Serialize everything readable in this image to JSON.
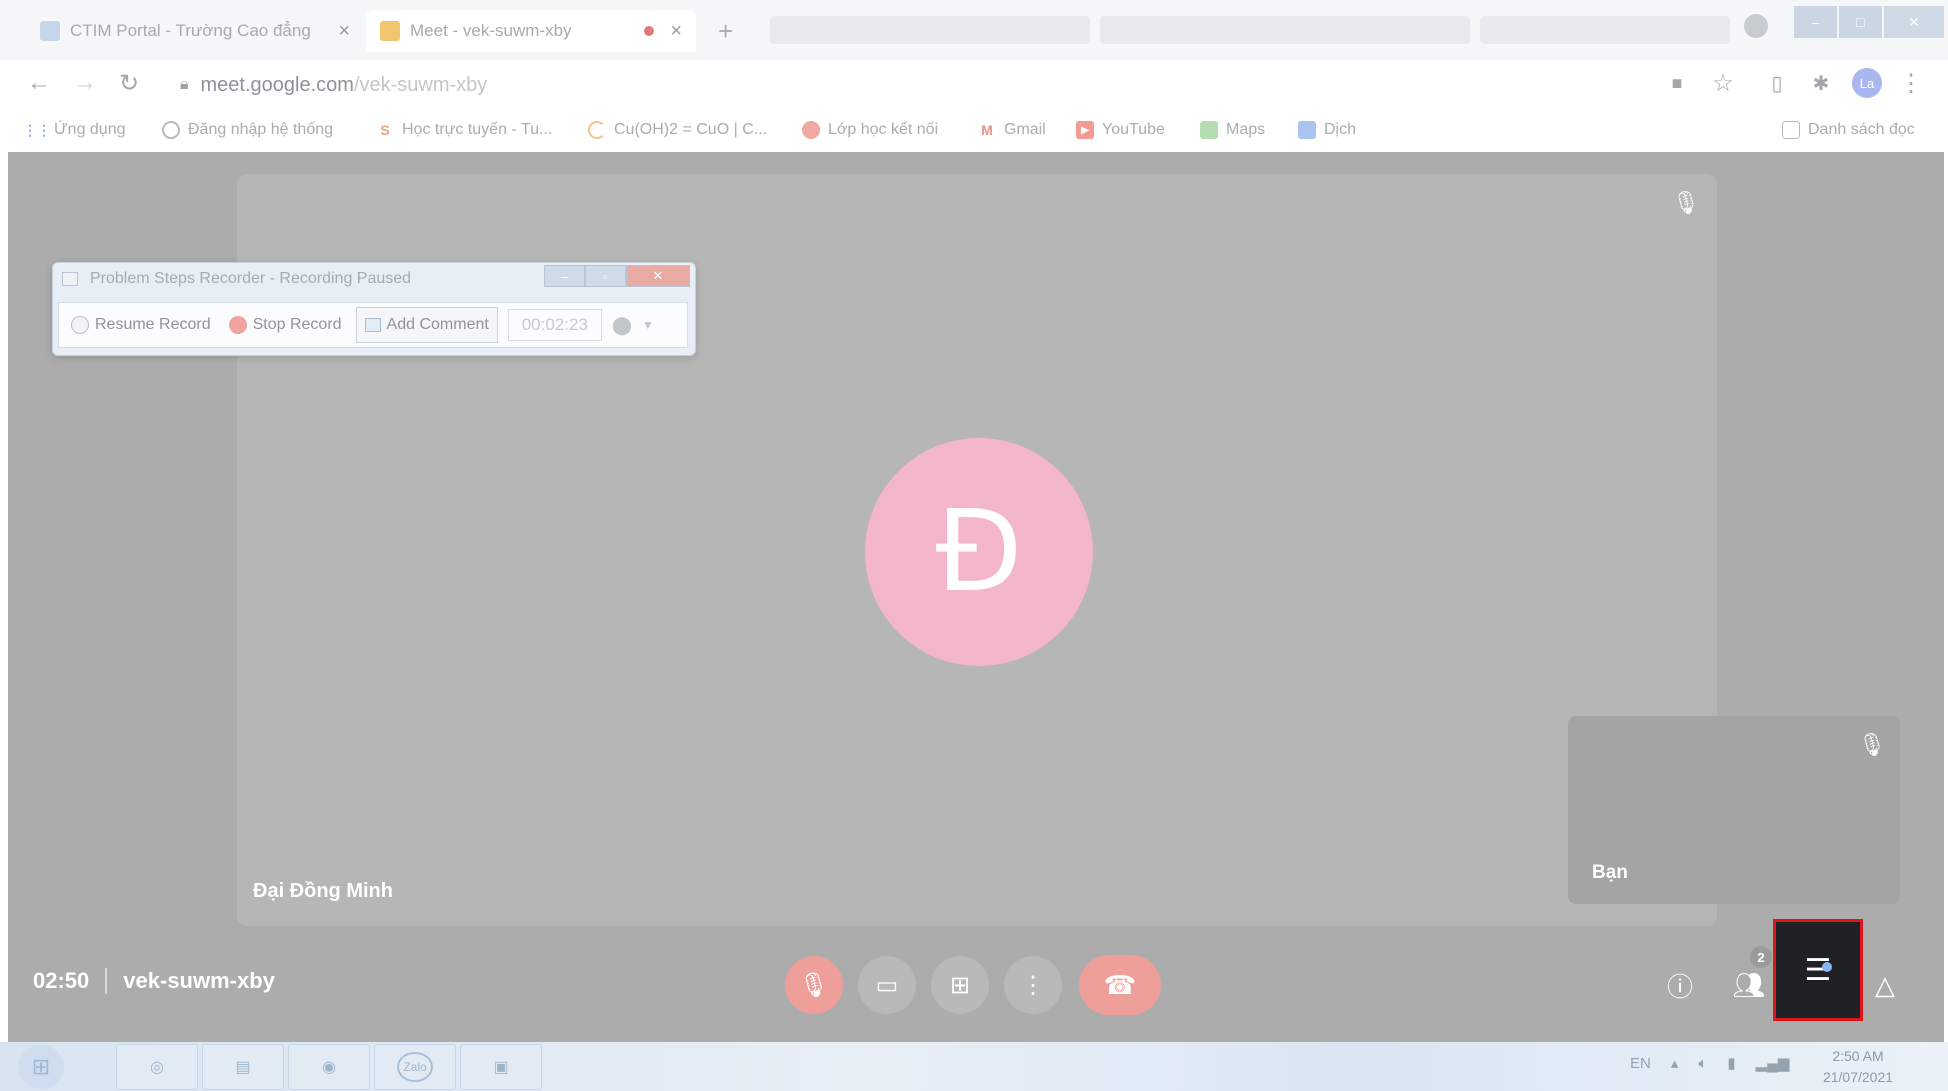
{
  "browser": {
    "tabs": [
      {
        "title": "CTIM Portal - Trường Cao đẳng",
        "close": "×"
      },
      {
        "title": "Meet - vek-suwm-xby",
        "close": "×"
      }
    ],
    "new_tab": "+",
    "url_host": "meet.google.com",
    "url_path": "/vek-suwm-xby",
    "profile_initials": "La",
    "bookmarks": [
      {
        "label": "Ứng dụng",
        "icon": "apps-icon"
      },
      {
        "label": "Đăng nhập hệ thống",
        "icon": "globe-icon"
      },
      {
        "label": "Học trực tuyến - Tu...",
        "icon": "s-logo-icon"
      },
      {
        "label": "Cu(OH)2 = CuO | C...",
        "icon": "loading-icon"
      },
      {
        "label": "Lớp học kết nối",
        "icon": "school-icon"
      },
      {
        "label": "Gmail",
        "icon": "gmail-icon"
      },
      {
        "label": "YouTube",
        "icon": "youtube-icon"
      },
      {
        "label": "Maps",
        "icon": "maps-icon"
      },
      {
        "label": "Dịch",
        "icon": "translate-icon"
      }
    ],
    "reading_list": "Danh sách đọc"
  },
  "meet": {
    "main_participant": {
      "initial": "Đ",
      "name": "Đại Đồng Minh",
      "avatar_color": "#f4b6c9"
    },
    "self_tile": {
      "name": "Bạn"
    },
    "elapsed": "02:50",
    "meeting_code": "vek-suwm-xby",
    "participant_count": "2"
  },
  "psr": {
    "title": "Problem Steps Recorder - Recording Paused",
    "resume": "Resume Record",
    "stop": "Stop Record",
    "add_comment": "Add Comment",
    "timer": "00:02:23"
  },
  "taskbar": {
    "zalo": "Zalo",
    "lang": "EN",
    "time": "2:50 AM",
    "date": "21/07/2021"
  },
  "colors": {
    "meet_bg": "#acacac",
    "end_call": "#ef9f9a",
    "chat_highlight": "#e0141b"
  }
}
